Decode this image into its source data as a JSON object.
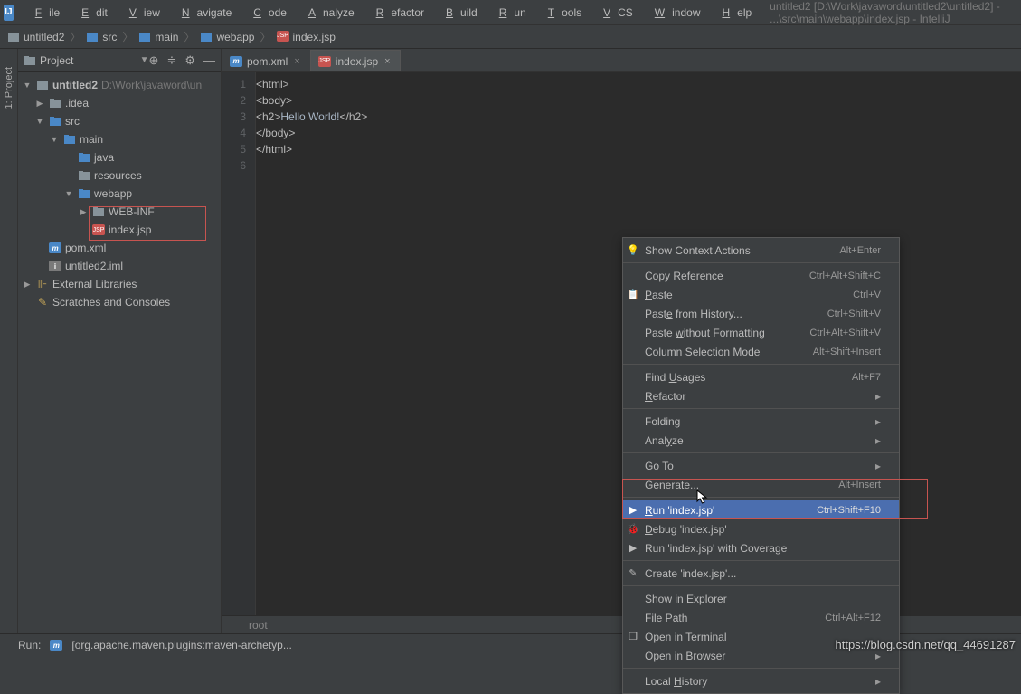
{
  "title": "untitled2 [D:\\Work\\javaword\\untitled2\\untitled2] - ...\\src\\main\\webapp\\index.jsp - IntelliJ",
  "menu": [
    "File",
    "Edit",
    "View",
    "Navigate",
    "Code",
    "Analyze",
    "Refactor",
    "Build",
    "Run",
    "Tools",
    "VCS",
    "Window",
    "Help"
  ],
  "breadcrumb": [
    {
      "icon": "folder",
      "text": "untitled2"
    },
    {
      "icon": "folder-blue",
      "text": "src"
    },
    {
      "icon": "folder-blue",
      "text": "main"
    },
    {
      "icon": "folder-web",
      "text": "webapp"
    },
    {
      "icon": "jsp",
      "text": "index.jsp"
    }
  ],
  "left_gutter": "1: Project",
  "project_label": "Project",
  "tree": [
    {
      "indent": 0,
      "arrow": "▼",
      "icon": "folder",
      "label": "untitled2",
      "path": "D:\\Work\\javaword\\un",
      "bold": true
    },
    {
      "indent": 1,
      "arrow": "▶",
      "icon": "folder",
      "label": ".idea"
    },
    {
      "indent": 1,
      "arrow": "▼",
      "icon": "folder-blue",
      "label": "src"
    },
    {
      "indent": 2,
      "arrow": "▼",
      "icon": "folder-blue",
      "label": "main"
    },
    {
      "indent": 3,
      "arrow": "",
      "icon": "folder-blue",
      "label": "java"
    },
    {
      "indent": 3,
      "arrow": "",
      "icon": "folder",
      "label": "resources"
    },
    {
      "indent": 3,
      "arrow": "▼",
      "icon": "folder-web",
      "label": "webapp"
    },
    {
      "indent": 4,
      "arrow": "▶",
      "icon": "folder",
      "label": "WEB-INF"
    },
    {
      "indent": 4,
      "arrow": "",
      "icon": "jsp",
      "label": "index.jsp",
      "boxed": true
    },
    {
      "indent": 1,
      "arrow": "",
      "icon": "m",
      "label": "pom.xml"
    },
    {
      "indent": 1,
      "arrow": "",
      "icon": "i",
      "label": "untitled2.iml"
    },
    {
      "indent": 0,
      "arrow": "▶",
      "icon": "lib",
      "label": "External Libraries"
    },
    {
      "indent": 0,
      "arrow": "",
      "icon": "scratch",
      "label": "Scratches and Consoles"
    }
  ],
  "tabs": [
    {
      "icon": "m",
      "label": "pom.xml",
      "active": false
    },
    {
      "icon": "jsp",
      "label": "index.jsp",
      "active": true
    }
  ],
  "code": [
    "<html>",
    "<body>",
    "<h2>Hello World!</h2>",
    "</body>",
    "</html>",
    ""
  ],
  "status_text": "root",
  "bottom_label": "Run:",
  "bottom_task": "[org.apache.maven.plugins:maven-archetyp...",
  "watermark": "https://blog.csdn.net/qq_44691287",
  "context": [
    {
      "type": "item",
      "icon": "bulb",
      "label": "Show Context Actions",
      "short": "Alt+Enter"
    },
    {
      "type": "sep"
    },
    {
      "type": "item",
      "label": "Copy Reference",
      "short": "Ctrl+Alt+Shift+C"
    },
    {
      "type": "item",
      "icon": "paste",
      "label": "Paste",
      "mn": 0,
      "short": "Ctrl+V"
    },
    {
      "type": "item",
      "label": "Paste from History...",
      "mn": 4,
      "short": "Ctrl+Shift+V"
    },
    {
      "type": "item",
      "label": "Paste without Formatting",
      "mn": 6,
      "short": "Ctrl+Alt+Shift+V"
    },
    {
      "type": "item",
      "label": "Column Selection Mode",
      "mn": 17,
      "short": "Alt+Shift+Insert"
    },
    {
      "type": "sep"
    },
    {
      "type": "item",
      "label": "Find Usages",
      "mn": 5,
      "short": "Alt+F7"
    },
    {
      "type": "item",
      "label": "Refactor",
      "mn": 0,
      "sub": true
    },
    {
      "type": "sep"
    },
    {
      "type": "item",
      "label": "Folding",
      "sub": true
    },
    {
      "type": "item",
      "label": "Analyze",
      "mn": 4,
      "sub": true
    },
    {
      "type": "sep"
    },
    {
      "type": "item",
      "label": "Go To",
      "sub": true
    },
    {
      "type": "item",
      "label": "Generate...",
      "short": "Alt+Insert"
    },
    {
      "type": "sep"
    },
    {
      "type": "item",
      "icon": "run",
      "label": "Run 'index.jsp'",
      "mn": 0,
      "short": "Ctrl+Shift+F10",
      "selected": true
    },
    {
      "type": "item",
      "icon": "debug",
      "label": "Debug 'index.jsp'",
      "mn": 0
    },
    {
      "type": "item",
      "icon": "cover",
      "label": "Run 'index.jsp' with Coverage"
    },
    {
      "type": "sep"
    },
    {
      "type": "item",
      "icon": "edit",
      "label": "Create 'index.jsp'..."
    },
    {
      "type": "sep"
    },
    {
      "type": "item",
      "label": "Show in Explorer"
    },
    {
      "type": "item",
      "label": "File Path",
      "mn": 5,
      "short": "Ctrl+Alt+F12"
    },
    {
      "type": "item",
      "icon": "term",
      "label": "Open in Terminal"
    },
    {
      "type": "item",
      "label": "Open in Browser",
      "mn": 8,
      "sub": true
    },
    {
      "type": "sep"
    },
    {
      "type": "item",
      "label": "Local History",
      "mn": 6,
      "sub": true
    }
  ]
}
